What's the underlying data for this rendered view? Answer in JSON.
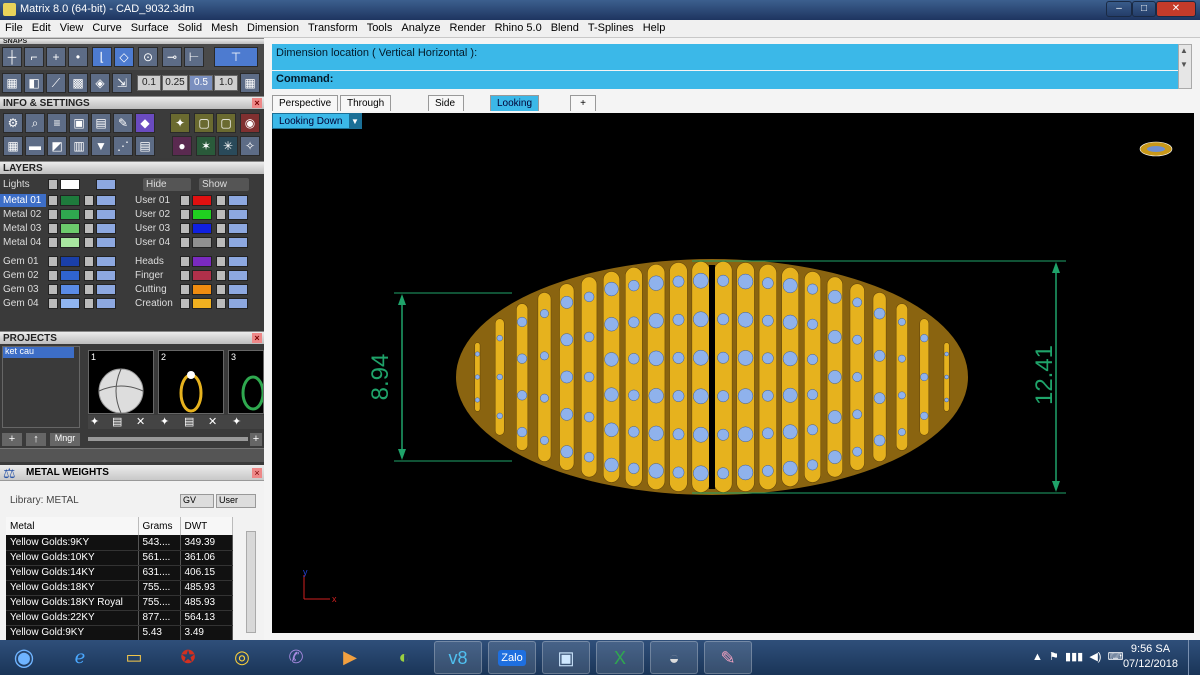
{
  "window": {
    "title": "Matrix 8.0 (64-bit) - CAD_9032.3dm",
    "min": "–",
    "max": "□",
    "close": "✕"
  },
  "menu": [
    "File",
    "Edit",
    "View",
    "Curve",
    "Surface",
    "Solid",
    "Mesh",
    "Dimension",
    "Transform",
    "Tools",
    "Analyze",
    "Render",
    "Rhino 5.0",
    "Blend",
    "T-Splines",
    "Help"
  ],
  "snaps": {
    "header": "SNAPS",
    "values": [
      "0.1",
      "0.25",
      "0.5",
      "1.0"
    ]
  },
  "info": {
    "header": "INFO & SETTINGS"
  },
  "layers": {
    "header": "LAYERS",
    "lights": "Lights",
    "hide": "Hide",
    "show": "Show",
    "metal": [
      {
        "name": "Metal 01",
        "color": "#1e7a3c"
      },
      {
        "name": "Metal 02",
        "color": "#2fa84f"
      },
      {
        "name": "Metal 03",
        "color": "#6ccb6c"
      },
      {
        "name": "Metal 04",
        "color": "#a8e6a0"
      }
    ],
    "user": [
      {
        "name": "User 01",
        "color": "#e01010"
      },
      {
        "name": "User 02",
        "color": "#20d020"
      },
      {
        "name": "User 03",
        "color": "#1020e0"
      },
      {
        "name": "User 04",
        "color": "#909090"
      }
    ],
    "gem": [
      {
        "name": "Gem 01",
        "color": "#1a3fa8"
      },
      {
        "name": "Gem 02",
        "color": "#2f64d0"
      },
      {
        "name": "Gem 03",
        "color": "#5a8be6"
      },
      {
        "name": "Gem 04",
        "color": "#8fb4f0"
      }
    ],
    "other": [
      {
        "name": "Heads",
        "color": "#7a2ac0"
      },
      {
        "name": "Finger",
        "color": "#b0304a"
      },
      {
        "name": "Cutting",
        "color": "#f08c10"
      },
      {
        "name": "Creation",
        "color": "#f0b020"
      }
    ]
  },
  "projects": {
    "header": "PROJECTS",
    "item": "ket cau",
    "thumbs": [
      "1",
      "2",
      "3"
    ],
    "mngr": "Mngr"
  },
  "weights": {
    "header": "METAL WEIGHTS",
    "library": "Library: METAL",
    "gv": "GV",
    "user": "User",
    "cols": [
      "Metal",
      "Grams",
      "DWT"
    ],
    "rows": [
      [
        "Yellow Golds:9KY",
        "543....",
        "349.39"
      ],
      [
        "Yellow Golds:10KY",
        "561....",
        "361.06"
      ],
      [
        "Yellow Golds:14KY",
        "631....",
        "406.15"
      ],
      [
        "Yellow Golds:18KY",
        "755....",
        "485.93"
      ],
      [
        "Yellow Golds:18KY Royal",
        "755....",
        "485.93"
      ],
      [
        "Yellow Golds:22KY",
        "877....",
        "564.13"
      ],
      [
        "Yellow Gold:9KY",
        "5.43",
        "3.49"
      ]
    ]
  },
  "dimension": {
    "prompt": "Dimension location ( Vertical  Horizontal ):",
    "command": "Command:"
  },
  "tabs": [
    "Perspective",
    "Through Finger",
    "Side View",
    "Looking Down",
    "+"
  ],
  "viewport": {
    "name": "Looking Down",
    "dim_left": "8.94",
    "dim_right": "12.41",
    "axis_y": "y",
    "axis_x": "x"
  },
  "colors": {
    "gold": "#e6b21e",
    "gem": "#8fb2ec",
    "dim": "#1fa36a",
    "accent": "#3bb8e8"
  },
  "taskbar": {
    "time": "9:56 SA",
    "date": "07/12/2018",
    "zalo": "Zalo"
  }
}
